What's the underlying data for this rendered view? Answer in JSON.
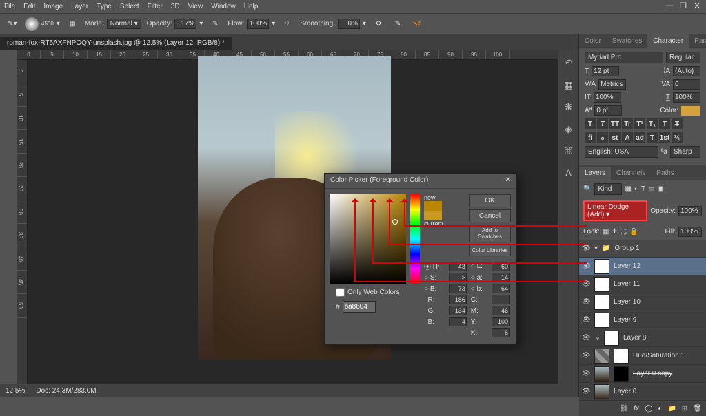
{
  "menu": [
    "File",
    "Edit",
    "Image",
    "Layer",
    "Type",
    "Select",
    "Filter",
    "3D",
    "View",
    "Window",
    "Help"
  ],
  "options": {
    "brush_size": "4500",
    "mode_label": "Mode:",
    "mode_value": "Normal",
    "opacity_label": "Opacity:",
    "opacity_value": "17%",
    "flow_label": "Flow:",
    "flow_value": "100%",
    "smoothing_label": "Smoothing:",
    "smoothing_value": "0%"
  },
  "doc_tab": "roman-fox-RT5AXFNPOQY-unsplash.jpg @ 12.5% (Layer 12, RGB/8) *",
  "rulerH": [
    "0",
    "5",
    "10",
    "15",
    "20",
    "25",
    "30",
    "35",
    "40",
    "45",
    "50",
    "55",
    "60",
    "65",
    "70",
    "75",
    "80",
    "85",
    "90",
    "95",
    "100"
  ],
  "rulerV": [
    "0",
    "5",
    "10",
    "15",
    "20",
    "25",
    "30",
    "35",
    "40",
    "45",
    "50"
  ],
  "char_tabs": [
    "Color",
    "Swatches",
    "Character",
    "Paragraph"
  ],
  "char": {
    "font": "Myriad Pro",
    "style": "Regular",
    "size": "12 pt",
    "leading": "(Auto)",
    "kerning": "Metrics",
    "tracking": "0",
    "vscale": "100%",
    "hscale": "100%",
    "baseline": "0 pt",
    "color_label": "Color:",
    "lang": "English: USA",
    "aa": "Sharp"
  },
  "layers_tabs": [
    "Layers",
    "Channels",
    "Paths"
  ],
  "layers": {
    "kind": "Kind",
    "blend_mode": "Linear Dodge (Add)",
    "opacity_label": "Opacity:",
    "opacity": "100%",
    "lock_label": "Lock:",
    "fill_label": "Fill:",
    "fill": "100%",
    "items": [
      {
        "name": "Group 1",
        "type": "group"
      },
      {
        "name": "Layer 12",
        "type": "white",
        "sel": true
      },
      {
        "name": "Layer 11",
        "type": "white"
      },
      {
        "name": "Layer 10",
        "type": "white"
      },
      {
        "name": "Layer 9",
        "type": "white"
      },
      {
        "name": "Layer 8",
        "type": "white",
        "indent": true
      },
      {
        "name": "Hue/Saturation 1",
        "type": "adj"
      },
      {
        "name": "Layer 0 copy",
        "type": "img",
        "mask": true,
        "strike": true
      },
      {
        "name": "Layer 0",
        "type": "img"
      }
    ]
  },
  "picker": {
    "title": "Color Picker (Foreground Color)",
    "ok": "OK",
    "cancel": "Cancel",
    "add": "Add to Swatches",
    "libraries": "Color Libraries",
    "new_label": "new",
    "current_label": "current",
    "fields": {
      "H": "43",
      "S": ">",
      "B": "73",
      "R": "186",
      "G": "134",
      "Bv": "4",
      "L": "60",
      "a": "14",
      "b": "64",
      "C": "",
      "M": "46",
      "Y": "100",
      "K": "6"
    },
    "hex": "ba8604",
    "web_only": "Only Web Colors"
  },
  "status": {
    "zoom": "12.5%",
    "doc": "Doc: 24.3M/283.0M"
  }
}
